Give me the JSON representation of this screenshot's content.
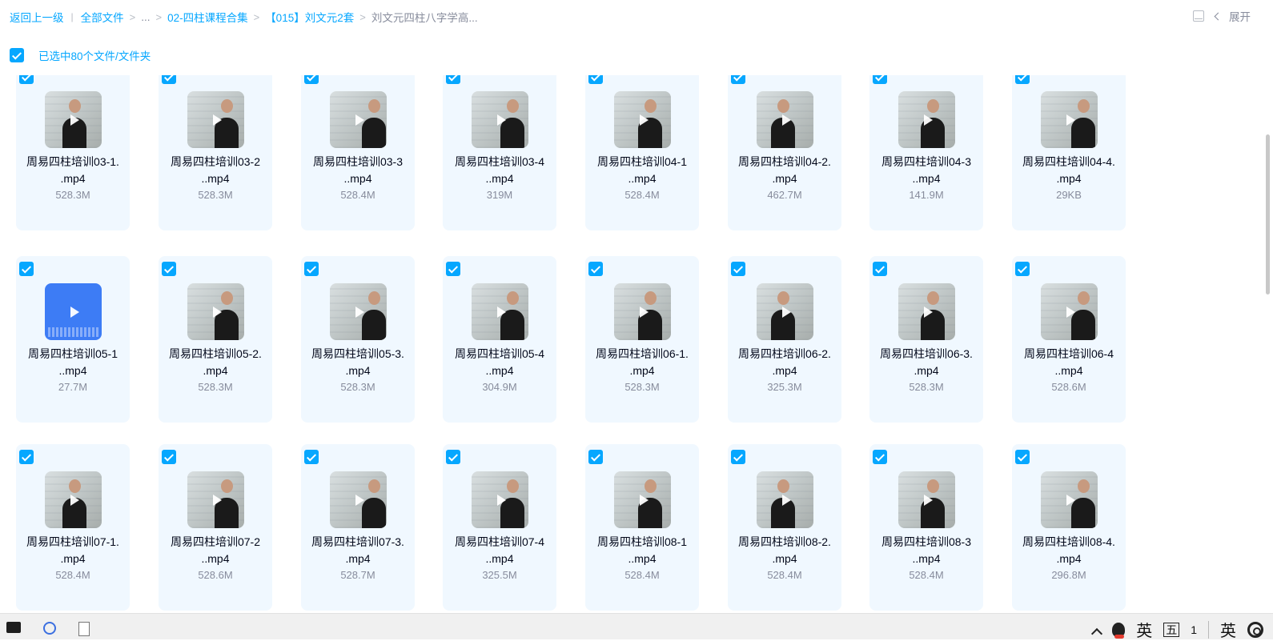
{
  "breadcrumb": {
    "back": "返回上一级",
    "all_files": "全部文件",
    "ellipsis": "...",
    "level1": "02-四柱课程合集",
    "level2": "【015】刘文元2套",
    "current": "刘文元四柱八字学高..."
  },
  "toolbar": {
    "expand_label": "展开"
  },
  "selection": {
    "label": "已选中80个文件/文件夹"
  },
  "files": [
    {
      "name_line1": "周易四柱培训03-1.",
      "name_line2": ".mp4",
      "size": "528.3M",
      "thumb": "video"
    },
    {
      "name_line1": "周易四柱培训03-2",
      "name_line2": "..mp4",
      "size": "528.3M",
      "thumb": "video"
    },
    {
      "name_line1": "周易四柱培训03-3",
      "name_line2": "..mp4",
      "size": "528.4M",
      "thumb": "video"
    },
    {
      "name_line1": "周易四柱培训03-4",
      "name_line2": "..mp4",
      "size": "319M",
      "thumb": "video"
    },
    {
      "name_line1": "周易四柱培训04-1",
      "name_line2": "..mp4",
      "size": "528.4M",
      "thumb": "video"
    },
    {
      "name_line1": "周易四柱培训04-2.",
      "name_line2": ".mp4",
      "size": "462.7M",
      "thumb": "video"
    },
    {
      "name_line1": "周易四柱培训04-3",
      "name_line2": "..mp4",
      "size": "141.9M",
      "thumb": "video"
    },
    {
      "name_line1": "周易四柱培训04-4.",
      "name_line2": ".mp4",
      "size": "29KB",
      "thumb": "video"
    },
    {
      "name_line1": "周易四柱培训05-1",
      "name_line2": "..mp4",
      "size": "27.7M",
      "thumb": "blue"
    },
    {
      "name_line1": "周易四柱培训05-2.",
      "name_line2": ".mp4",
      "size": "528.3M",
      "thumb": "video"
    },
    {
      "name_line1": "周易四柱培训05-3.",
      "name_line2": ".mp4",
      "size": "528.3M",
      "thumb": "video"
    },
    {
      "name_line1": "周易四柱培训05-4",
      "name_line2": "..mp4",
      "size": "304.9M",
      "thumb": "video"
    },
    {
      "name_line1": "周易四柱培训06-1.",
      "name_line2": ".mp4",
      "size": "528.3M",
      "thumb": "video"
    },
    {
      "name_line1": "周易四柱培训06-2.",
      "name_line2": ".mp4",
      "size": "325.3M",
      "thumb": "video"
    },
    {
      "name_line1": "周易四柱培训06-3.",
      "name_line2": ".mp4",
      "size": "528.3M",
      "thumb": "video"
    },
    {
      "name_line1": "周易四柱培训06-4",
      "name_line2": "..mp4",
      "size": "528.6M",
      "thumb": "video"
    },
    {
      "name_line1": "周易四柱培训07-1.",
      "name_line2": ".mp4",
      "size": "528.4M",
      "thumb": "video"
    },
    {
      "name_line1": "周易四柱培训07-2",
      "name_line2": "..mp4",
      "size": "528.6M",
      "thumb": "video"
    },
    {
      "name_line1": "周易四柱培训07-3.",
      "name_line2": ".mp4",
      "size": "528.7M",
      "thumb": "video"
    },
    {
      "name_line1": "周易四柱培训07-4",
      "name_line2": "..mp4",
      "size": "325.5M",
      "thumb": "video"
    },
    {
      "name_line1": "周易四柱培训08-1",
      "name_line2": "..mp4",
      "size": "528.4M",
      "thumb": "video"
    },
    {
      "name_line1": "周易四柱培训08-2.",
      "name_line2": ".mp4",
      "size": "528.4M",
      "thumb": "video"
    },
    {
      "name_line1": "周易四柱培训08-3",
      "name_line2": "..mp4",
      "size": "528.4M",
      "thumb": "video"
    },
    {
      "name_line1": "周易四柱培训08-4.",
      "name_line2": ".mp4",
      "size": "296.8M",
      "thumb": "video"
    }
  ],
  "taskbar": {
    "ime_lang": "英",
    "ime_mode": "五",
    "counter": "1",
    "ime_lang2": "英"
  },
  "colors": {
    "accent": "#06a7ff",
    "card_bg": "#f0f8ff",
    "muted": "#878c9c"
  }
}
